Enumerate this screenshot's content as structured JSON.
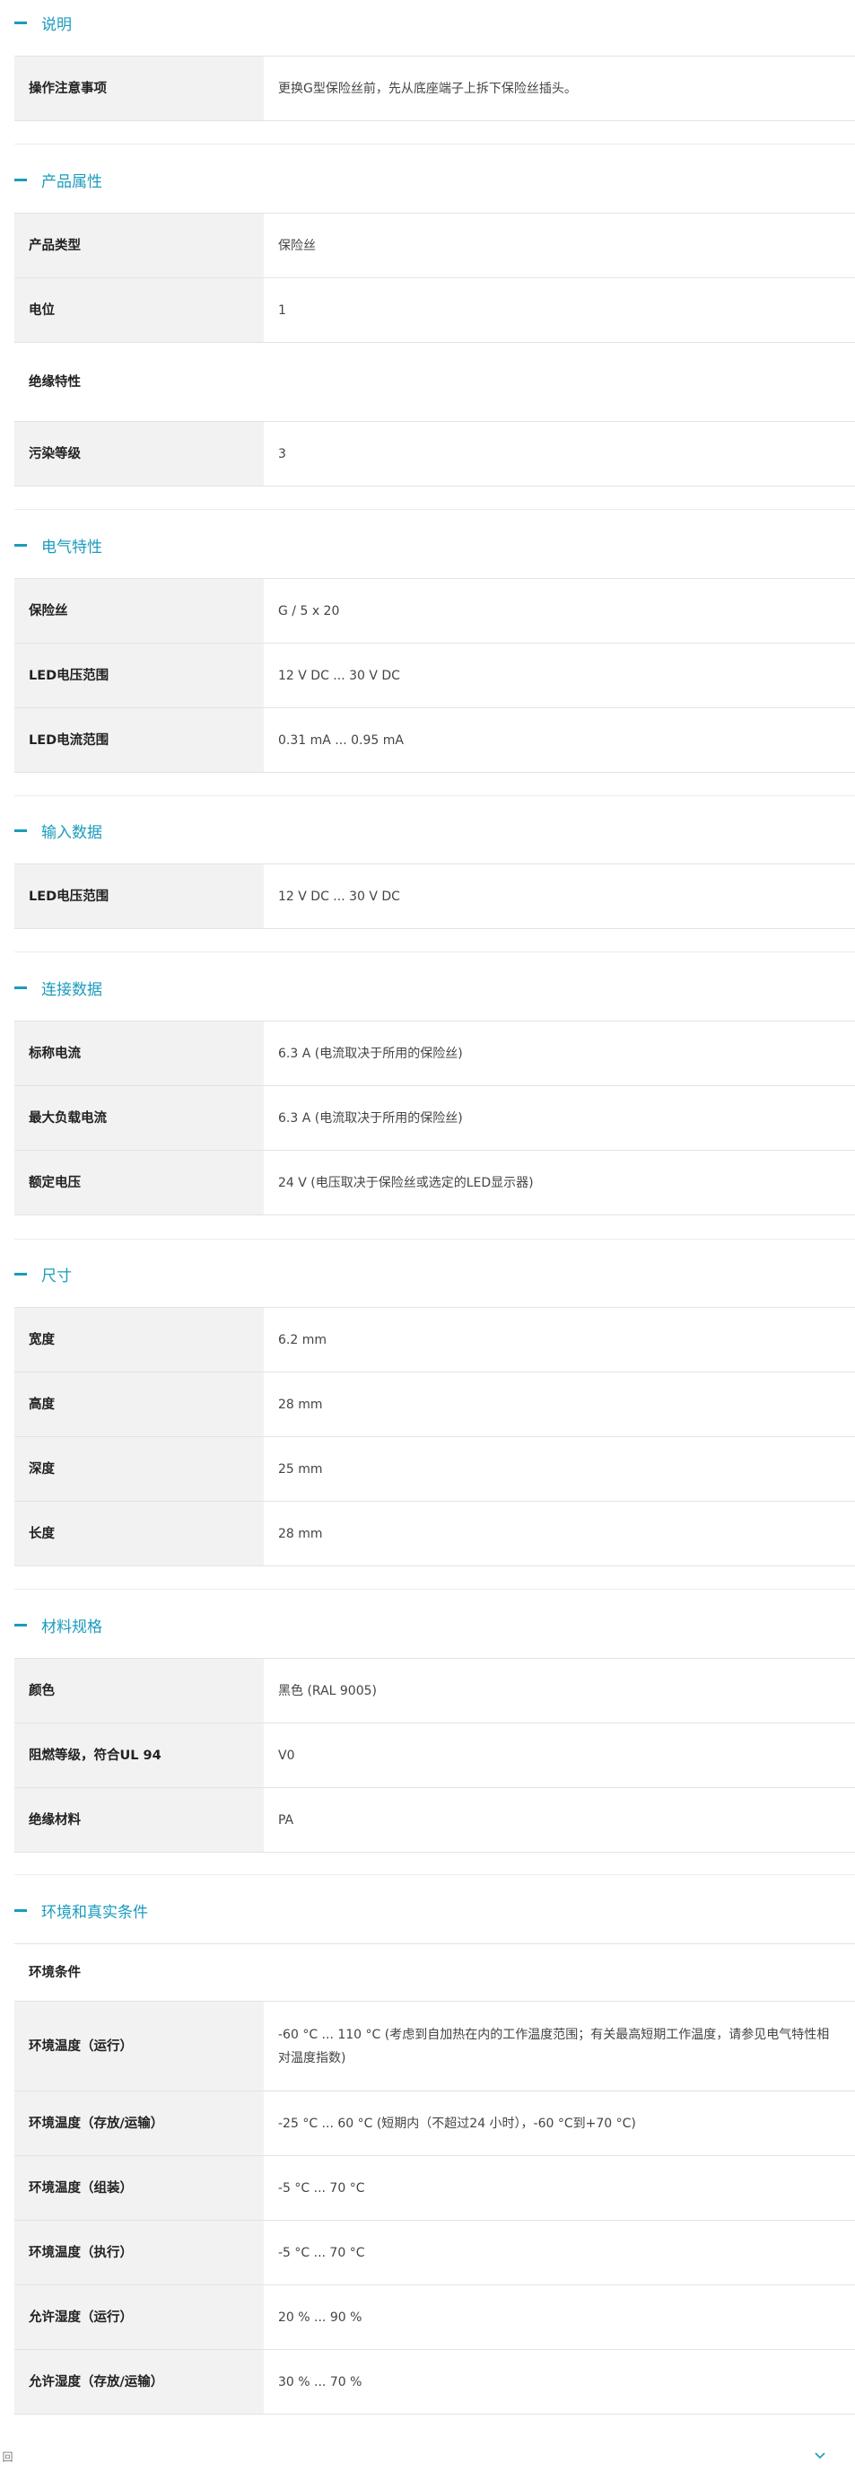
{
  "sections": [
    {
      "title": "说明"
    },
    {
      "title": "产品属性"
    },
    {
      "title": "电气特性"
    },
    {
      "title": "输入数据"
    },
    {
      "title": "连接数据"
    },
    {
      "title": "尺寸"
    },
    {
      "title": "材料规格"
    },
    {
      "title": "环境和真实条件"
    }
  ],
  "description": {
    "rows": [
      {
        "label": "操作注意事项",
        "value": "更换G型保险丝前，先从底座端子上拆下保险丝插头。"
      }
    ]
  },
  "product_properties": {
    "rows": [
      {
        "label": "产品类型",
        "value": "保险丝"
      },
      {
        "label": "电位",
        "value": "1"
      }
    ],
    "insulation_heading": "绝缘特性",
    "insulation_rows": [
      {
        "label": "污染等级",
        "value": "3"
      }
    ]
  },
  "electrical": {
    "rows": [
      {
        "label": "保险丝",
        "value": "G / 5 x 20"
      },
      {
        "label": "LED电压范围",
        "value": "12 V DC ... 30 V DC"
      },
      {
        "label": "LED电流范围",
        "value": "0.31 mA ... 0.95 mA"
      }
    ]
  },
  "input_data": {
    "rows": [
      {
        "label": "LED电压范围",
        "value": "12 V DC ... 30 V DC"
      }
    ]
  },
  "connection_data": {
    "rows": [
      {
        "label": "标称电流",
        "value": "6.3 A (电流取决于所用的保险丝)"
      },
      {
        "label": "最大负载电流",
        "value": "6.3 A (电流取决于所用的保险丝)"
      },
      {
        "label": "额定电压",
        "value": "24 V (电压取决于保险丝或选定的LED显示器)"
      }
    ]
  },
  "dimensions": {
    "rows": [
      {
        "label": "宽度",
        "value": "6.2 mm"
      },
      {
        "label": "高度",
        "value": "28 mm"
      },
      {
        "label": "深度",
        "value": "25 mm"
      },
      {
        "label": "长度",
        "value": "28 mm"
      }
    ]
  },
  "materials": {
    "rows": [
      {
        "label": "颜色",
        "value": "黑色 (RAL 9005)"
      },
      {
        "label": "阻燃等级，符合UL 94",
        "value": "V0"
      },
      {
        "label": "绝缘材料",
        "value": "PA"
      }
    ]
  },
  "environment": {
    "heading": "环境条件",
    "rows": [
      {
        "label": "环境温度（运行）",
        "value": "-60 °C ... 110 °C (考虑到自加热在内的工作温度范围；有关最高短期工作温度，请参见电气特性相对温度指数)"
      },
      {
        "label": "环境温度（存放/运输）",
        "value": "-25 °C ... 60 °C (短期内（不超过24 小时），-60 °C到+70 °C)"
      },
      {
        "label": "环境温度（组装）",
        "value": "-5 °C ... 70 °C"
      },
      {
        "label": "环境温度（执行）",
        "value": "-5 °C ... 70 °C"
      },
      {
        "label": "允许湿度（运行）",
        "value": "20 % ... 90 %"
      },
      {
        "label": "允许湿度（存放/运输）",
        "value": "30 % ... 70 %"
      }
    ]
  },
  "footer": {
    "edge_text": "回"
  },
  "colors": {
    "accent": "#1b9bbd",
    "label_bg": "#f2f2f2",
    "border": "#e3e3e3"
  }
}
